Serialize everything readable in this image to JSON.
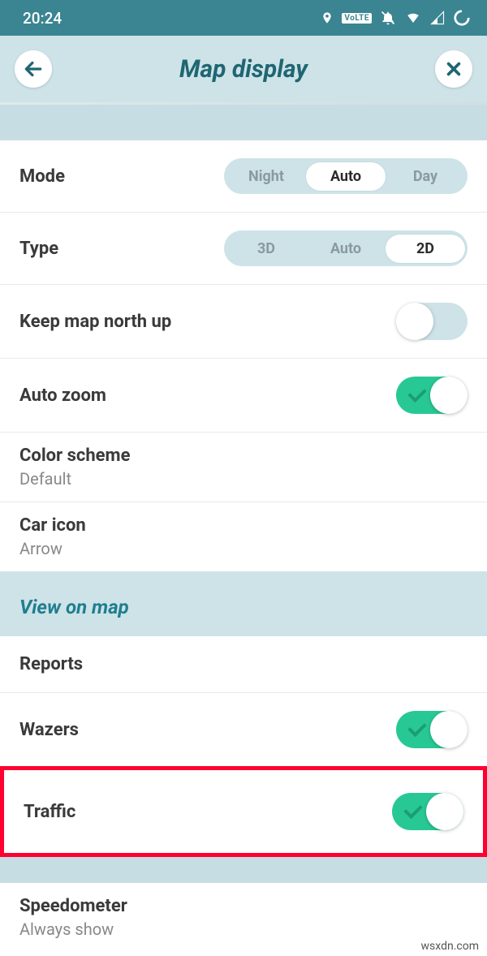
{
  "status": {
    "time": "20:24"
  },
  "header": {
    "title": "Map display"
  },
  "mode": {
    "label": "Mode",
    "options": {
      "night": "Night",
      "auto": "Auto",
      "day": "Day"
    }
  },
  "type": {
    "label": "Type",
    "options": {
      "threeD": "3D",
      "auto": "Auto",
      "twoD": "2D"
    }
  },
  "keepNorth": {
    "label": "Keep map north up"
  },
  "autoZoom": {
    "label": "Auto zoom"
  },
  "colorScheme": {
    "label": "Color scheme",
    "value": "Default"
  },
  "carIcon": {
    "label": "Car icon",
    "value": "Arrow"
  },
  "viewOnMap": {
    "header": "View on map"
  },
  "reports": {
    "label": "Reports"
  },
  "wazers": {
    "label": "Wazers"
  },
  "traffic": {
    "label": "Traffic"
  },
  "speedometer": {
    "label": "Speedometer",
    "value": "Always show"
  },
  "watermark": "wsxdn.com"
}
